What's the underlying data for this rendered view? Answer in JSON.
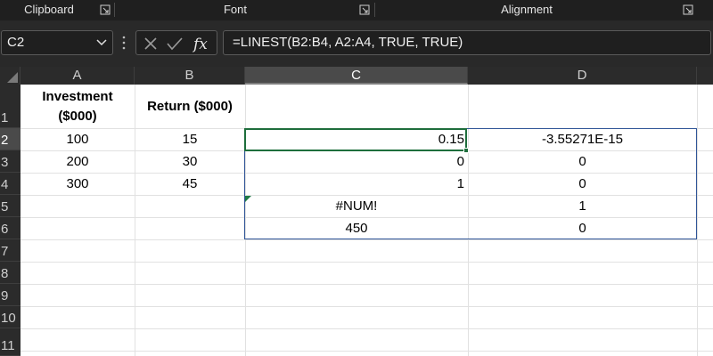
{
  "ribbon": {
    "groups": [
      {
        "label": "Clipboard"
      },
      {
        "label": "Font"
      },
      {
        "label": "Alignment"
      }
    ]
  },
  "formula_bar": {
    "name_box": "C2",
    "formula": "=LINEST(B2:B4, A2:A4, TRUE, TRUE)"
  },
  "columns": [
    "A",
    "B",
    "C",
    "D"
  ],
  "selected_column": "C",
  "rows": [
    "1",
    "2",
    "3",
    "4",
    "5",
    "6",
    "7",
    "8",
    "9",
    "10",
    "11"
  ],
  "selected_row": "2",
  "sheet": {
    "A1_line1": "Investment",
    "A1_line2": "($000)",
    "B1": "Return ($000)",
    "A2": "100",
    "B2": "15",
    "C2": "0.15",
    "D2": "-3.55271E-15",
    "A3": "200",
    "B3": "30",
    "C3": "0",
    "D3": "0",
    "A4": "300",
    "B4": "45",
    "C4": "1",
    "D4": "0",
    "C5": "#NUM!",
    "D5": "1",
    "C6": "450",
    "D6": "0"
  },
  "colors": {
    "active_cell_border": "#1e6e3c",
    "array_border": "#2f5597",
    "ribbon_bg": "#1f1f1f",
    "formula_bar_bg": "#292929"
  }
}
